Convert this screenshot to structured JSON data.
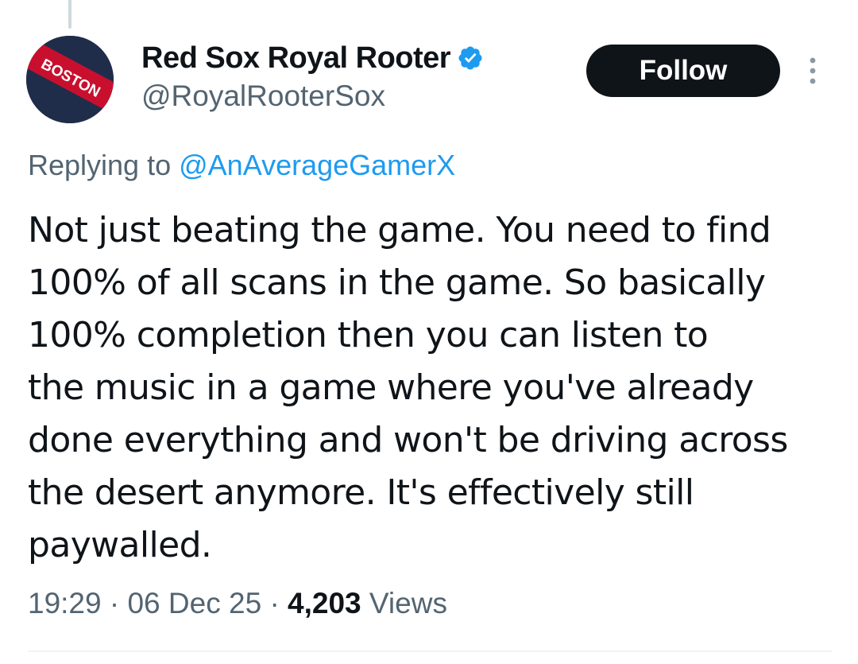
{
  "author": {
    "display_name": "Red Sox Royal Rooter",
    "handle": "@RoyalRooterSox",
    "avatar_text": "BOSTON",
    "verified": true
  },
  "actions": {
    "follow_label": "Follow",
    "more_icon": "more-vertical-icon"
  },
  "reply": {
    "prefix": "Replying to",
    "mention": "@AnAverageGamerX"
  },
  "tweet": {
    "lines": [
      "Not just beating the game. You need to find",
      "100% of all scans in the game. So basically",
      "100% completion then you can listen to",
      "the music in a game where you've already",
      "done everything and won't be driving across",
      "the desert anymore. It's effectively still",
      "paywalled."
    ]
  },
  "meta": {
    "time": "19:29",
    "separator": "·",
    "date": "06 Dec 25",
    "views_count": "4,203",
    "views_label": "Views"
  },
  "colors": {
    "text": "#0f1419",
    "secondary": "#536471",
    "accent": "#1d9bf0",
    "follow_bg": "#0f1419",
    "avatar_bg": "#1f2d4a",
    "avatar_band": "#c8102e"
  }
}
